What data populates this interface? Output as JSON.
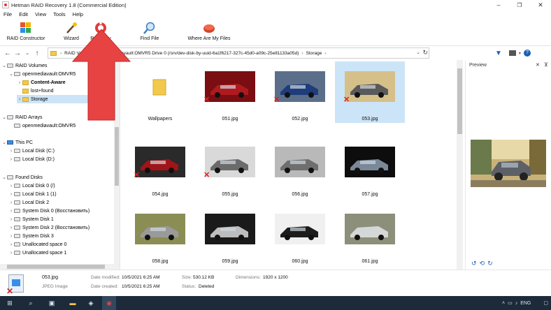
{
  "window": {
    "title": "Hetman RAID Recovery 1.8 (Commercial Edition)",
    "min": "–",
    "restore": "❐",
    "close": "✕"
  },
  "menu": [
    "File",
    "Edit",
    "View",
    "Tools",
    "Help"
  ],
  "ribbon": {
    "raid_constructor": "RAID Constructor",
    "wizard": "Wizard",
    "recovery": "Recovery",
    "find_file": "Find File",
    "where_files": "Where Are My Files"
  },
  "address": {
    "segments": [
      "RAID Volumes",
      "openmediavault:OMVR5 Drive 0 (/srv/dev-disk-by-uuid-6a1f6217-327c-45d0-a09c-25e81133a05d)",
      "Storage"
    ],
    "separator": "›"
  },
  "tree": {
    "raid_volumes": "RAID Volumes",
    "omv": "openmediavault:OMVR5",
    "content": "Content-Aware",
    "lost": "lost+found",
    "storage": "Storage",
    "raid_arrays": "RAID Arrays",
    "omv2": "openmediavault:OMVR5",
    "this_pc": "This PC",
    "local_c": "Local Disk (C:)",
    "local_d": "Local Disk (D:)",
    "found_disks": "Found Disks",
    "ld0": "Local Disk 0 (/)",
    "ld1": "Local Disk 1 (1)",
    "ld2": "Local Disk 2",
    "sd0": "System Disk 0 (Восстановить)",
    "sd1": "System Disk 1",
    "sd2": "System Disk 2 (Восстановить)",
    "sd3": "System Disk 3",
    "un0": "Unallocated space 0",
    "un1": "Unallocated space 1"
  },
  "files": [
    {
      "name": "Wallpapers",
      "folder": true,
      "deleted": false
    },
    {
      "name": "051.jpg",
      "folder": false,
      "deleted": true,
      "bg": "#7a0e12",
      "car": "#b01a1f"
    },
    {
      "name": "052.jpg",
      "folder": false,
      "deleted": true,
      "bg": "#5b6f8a",
      "car": "#1f3d7a"
    },
    {
      "name": "053.jpg",
      "folder": false,
      "deleted": true,
      "bg": "#d6c08a",
      "car": "#5a5a5a"
    },
    {
      "name": "054.jpg",
      "folder": false,
      "deleted": true,
      "bg": "#2a2a2a",
      "car": "#a11419"
    },
    {
      "name": "055.jpg",
      "folder": false,
      "deleted": true,
      "bg": "#d9d9d9",
      "car": "#6b6b6b"
    },
    {
      "name": "056.jpg",
      "folder": false,
      "deleted": false,
      "bg": "#b9b9b9",
      "car": "#6f6f6f"
    },
    {
      "name": "057.jpg",
      "folder": false,
      "deleted": false,
      "bg": "#0d0d0d",
      "car": "#7a8899"
    },
    {
      "name": "058.jpg",
      "folder": false,
      "deleted": false,
      "bg": "#8a8e55",
      "car": "#9a9a9a"
    },
    {
      "name": "059.jpg",
      "folder": false,
      "deleted": false,
      "bg": "#1a1a1a",
      "car": "#bdbdbd"
    },
    {
      "name": "060.jpg",
      "folder": false,
      "deleted": false,
      "bg": "#f0f0f0",
      "car": "#1c1c1c"
    },
    {
      "name": "061.jpg",
      "folder": false,
      "deleted": false,
      "bg": "#8c8f7a",
      "car": "#d7d7d7"
    }
  ],
  "preview": {
    "title": "Preview",
    "pin": "⊻",
    "close": "✕"
  },
  "status": {
    "filename": "053.jpg",
    "filetype": "JPEG Image",
    "date_modified_lbl": "Date modified:",
    "date_modified": "10/5/2021 6:25 AM",
    "date_created_lbl": "Date created:",
    "date_created": "10/5/2021 6:25 AM",
    "size_lbl": "Size:",
    "size": "530.12 KB",
    "status_lbl": "Status:",
    "status": "Deleted",
    "dimensions_lbl": "Dimensions:",
    "dimensions": "1920 x 1200"
  },
  "taskbar": {
    "lang": "ENG"
  },
  "colors": {
    "accent": "#cce4f7",
    "arrow": "#e84343",
    "deleted": "#e02020",
    "taskbar": "#1c2a3a"
  }
}
